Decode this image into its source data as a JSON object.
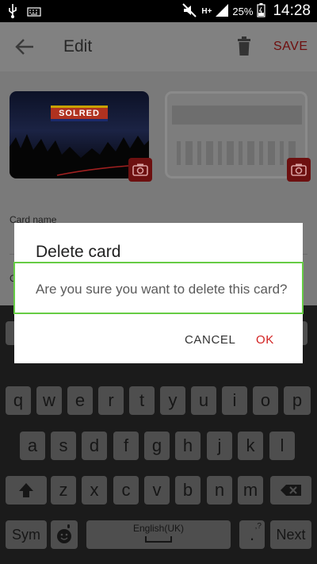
{
  "status_bar": {
    "network": "H+",
    "battery": "25%",
    "time": "14:28"
  },
  "app_bar": {
    "title": "Edit",
    "save_label": "SAVE"
  },
  "content": {
    "card_logo_text": "SOLRED",
    "card_name_label": "Card name",
    "second_label_partial": "C"
  },
  "dialog": {
    "title": "Delete card",
    "message": "Are you sure you want to delete this card?",
    "cancel_label": "CANCEL",
    "ok_label": "OK"
  },
  "keyboard": {
    "row1": [
      "q",
      "w",
      "e",
      "r",
      "t",
      "y",
      "u",
      "i",
      "o",
      "p"
    ],
    "row2": [
      "a",
      "s",
      "d",
      "f",
      "g",
      "h",
      "j",
      "k",
      "l"
    ],
    "row3": [
      "z",
      "x",
      "c",
      "v",
      "b",
      "n",
      "m"
    ],
    "sym_label": "Sym",
    "space_label": "English(UK)",
    "period_label": ".",
    "next_label": "Next"
  },
  "colors": {
    "accent": "#d21f1f",
    "focus_outline": "#66cc44"
  },
  "icons": [
    "usb-icon",
    "keyboard-icon",
    "mute-icon",
    "signal-icon",
    "battery-icon",
    "back-arrow-icon",
    "trash-icon",
    "camera-icon",
    "shift-icon",
    "backspace-icon",
    "emoji-mic-icon"
  ]
}
